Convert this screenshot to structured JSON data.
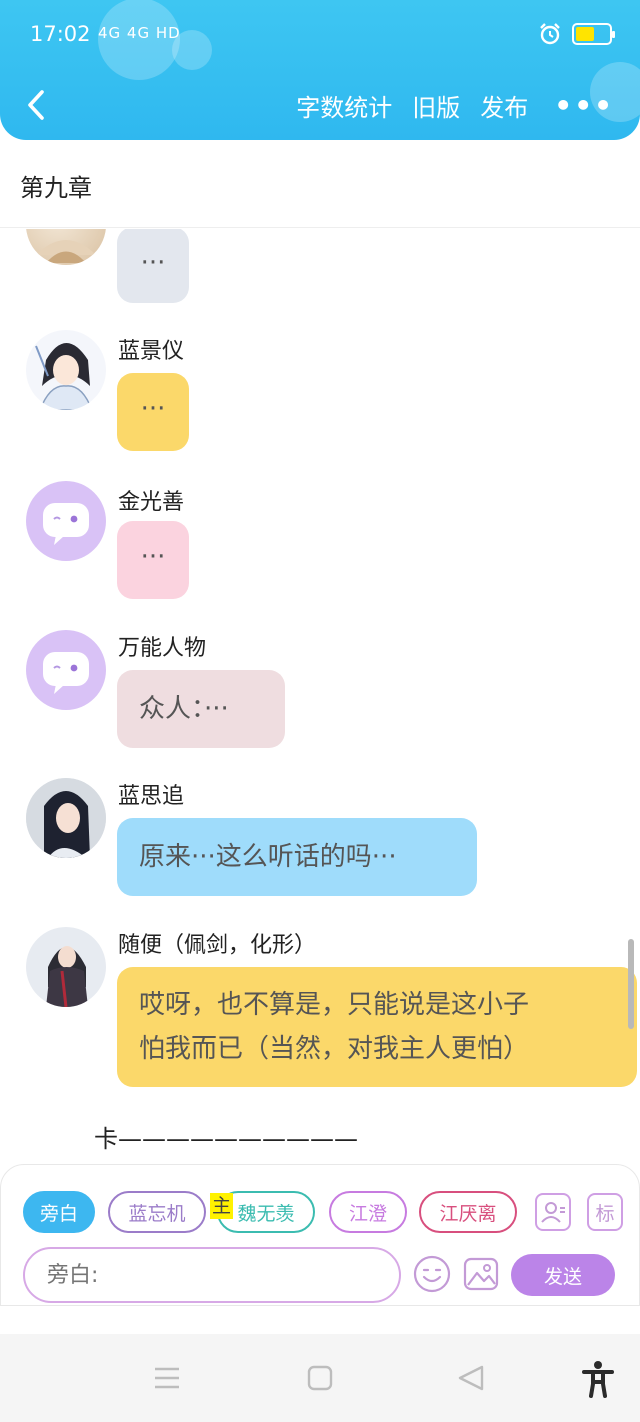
{
  "status_bar": {
    "time": "17:02",
    "network": "4G 4G HD",
    "battery_level": 0.55,
    "battery_color": "#ffe400"
  },
  "header": {
    "accent": "#3ec6f2",
    "back_icon": "chevron-left-icon",
    "nav": [
      "字数统计",
      "旧版",
      "发布"
    ],
    "more_label": "•••"
  },
  "chapter": {
    "title": "第九章"
  },
  "messages": [
    {
      "name": "",
      "text": "···",
      "bubble_color": "#e3e7ee",
      "avatar": "character-portrait"
    },
    {
      "name": "蓝景仪",
      "text": "···",
      "bubble_color": "#fbd86a",
      "avatar": "character-portrait"
    },
    {
      "name": "金光善",
      "text": "···",
      "bubble_color": "#fbd3df",
      "avatar": "chat-bubble-icon"
    },
    {
      "name": "万能人物",
      "text": "众人：···",
      "bubble_color": "#efdde0",
      "avatar": "chat-bubble-icon"
    },
    {
      "name": "蓝思追",
      "text": "原来···这么听话的吗···",
      "bubble_color": "#9fdcfb",
      "avatar": "character-portrait"
    },
    {
      "name": "随便（佩剑，化形）",
      "text_lines": [
        "哎呀，也不算是，只能说是这小子",
        "怕我而已（当然，对我主人更怕）"
      ],
      "bubble_color": "#fbd86a",
      "avatar": "character-portrait"
    }
  ],
  "end_marker": "卡——————————",
  "role_chips": [
    {
      "label": "旁白",
      "color": "#3db7f0",
      "selected": true
    },
    {
      "label": "蓝忘机",
      "color": "#9b7cc9",
      "selected": false
    },
    {
      "label": "魏无羡",
      "color": "#3bbcb0",
      "selected": false,
      "mark": "主"
    },
    {
      "label": "江澄",
      "color": "#c77be0",
      "selected": false
    },
    {
      "label": "江厌离",
      "color": "#d84f7e",
      "selected": false
    }
  ],
  "panel_icons": {
    "contact": "contact-card-icon",
    "tag_label": "标"
  },
  "input": {
    "placeholder": "旁白:"
  },
  "send_label": "发送",
  "system_nav": [
    "menu-icon",
    "home-icon",
    "back-triangle-icon",
    "accessibility-icon"
  ]
}
